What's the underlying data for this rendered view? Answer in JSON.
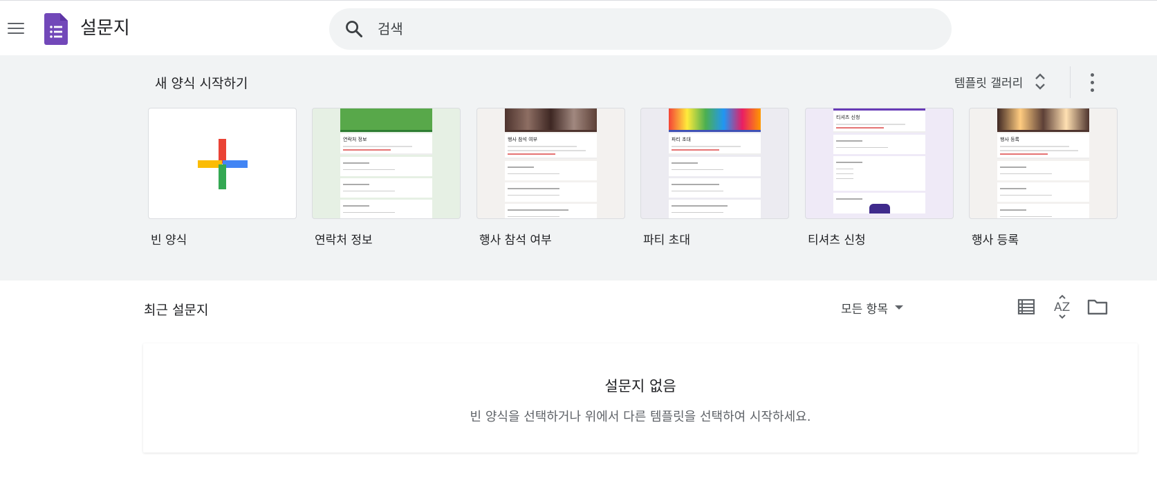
{
  "header": {
    "app_title": "설문지",
    "search_placeholder": "검색",
    "logo_color": "#7248b9"
  },
  "templates": {
    "heading": "새 양식 시작하기",
    "gallery_label": "템플릿 갤러리",
    "cards": [
      {
        "label": "빈 양식",
        "thumb": "blank"
      },
      {
        "label": "연락처 정보",
        "thumb": "contact",
        "preview_title": "연락처 정보",
        "banner_color": "#4caf50"
      },
      {
        "label": "행사 참석 여부",
        "thumb": "rsvp",
        "preview_title": "행사 참석 여부",
        "banner_color": "#5d4037"
      },
      {
        "label": "파티 초대",
        "thumb": "party",
        "preview_title": "파티 초대",
        "banner_color": "#7986cb"
      },
      {
        "label": "티셔츠 신청",
        "thumb": "tshirt",
        "preview_title": "티셔츠 신청",
        "banner_color": "#673ab7"
      },
      {
        "label": "행사 등록",
        "thumb": "event",
        "preview_title": "행사 등록",
        "banner_color": "#6d4c41"
      }
    ]
  },
  "recent": {
    "heading": "최근 설문지",
    "owner_filter": "모든 항목",
    "empty_title": "설문지 없음",
    "empty_subtitle": "빈 양식을 선택하거나 위에서 다른 템플릿을 선택하여 시작하세요."
  },
  "colors": {
    "accent": "#673ab7",
    "plus_red": "#ea4335",
    "plus_blue": "#4285f4",
    "plus_green": "#34a853",
    "plus_yellow": "#fbbc04"
  }
}
